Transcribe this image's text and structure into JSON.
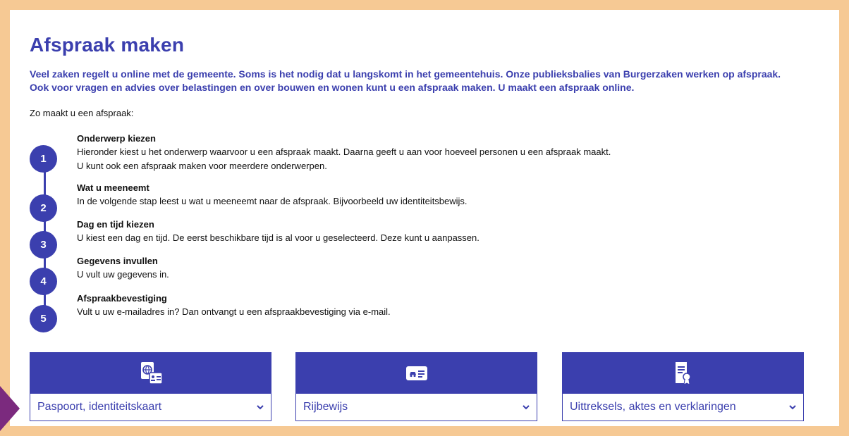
{
  "page": {
    "title": "Afspraak maken",
    "intro": [
      "Veel zaken regelt u online met de gemeente. Soms is het nodig dat u langskomt in het gemeentehuis. Onze publieksbalies van Burgerzaken werken op afspraak.",
      "Ook voor vragen en advies over belastingen en over bouwen en wonen kunt u een afspraak maken. U maakt een afspraak online."
    ],
    "howto": "Zo maakt u een afspraak:"
  },
  "steps": [
    {
      "num": "1",
      "title": "Onderwerp kiezen",
      "lines": [
        "Hieronder kiest u het onderwerp waarvoor u een afspraak maakt. Daarna geeft u aan voor hoeveel personen u een afspraak maakt.",
        "U kunt ook een afspraak maken voor meerdere onderwerpen."
      ]
    },
    {
      "num": "2",
      "title": "Wat u meeneemt",
      "lines": [
        "In de volgende stap leest u wat u meeneemt naar de afspraak. Bijvoorbeeld uw identiteitsbewijs."
      ]
    },
    {
      "num": "3",
      "title": "Dag en tijd kiezen",
      "lines": [
        "U kiest een dag en tijd. De eerst beschikbare tijd is al voor u geselecteerd. Deze kunt u aanpassen."
      ]
    },
    {
      "num": "4",
      "title": "Gegevens invullen",
      "lines": [
        "U vult uw gegevens in."
      ]
    },
    {
      "num": "5",
      "title": "Afspraakbevestiging",
      "lines": [
        "Vult u uw e-mailadres in? Dan ontvangt u een afspraakbevestiging via e-mail."
      ]
    }
  ],
  "cards": [
    {
      "label": "Paspoort, identiteitskaart",
      "icon": "passport-id-icon"
    },
    {
      "label": "Rijbewijs",
      "icon": "drivers-license-icon"
    },
    {
      "label": "Uittreksels, aktes en verklaringen",
      "icon": "certificate-document-icon"
    }
  ],
  "colors": {
    "accent": "#3b3fae",
    "background": "#f6c994",
    "marker": "#7b2a7e"
  }
}
